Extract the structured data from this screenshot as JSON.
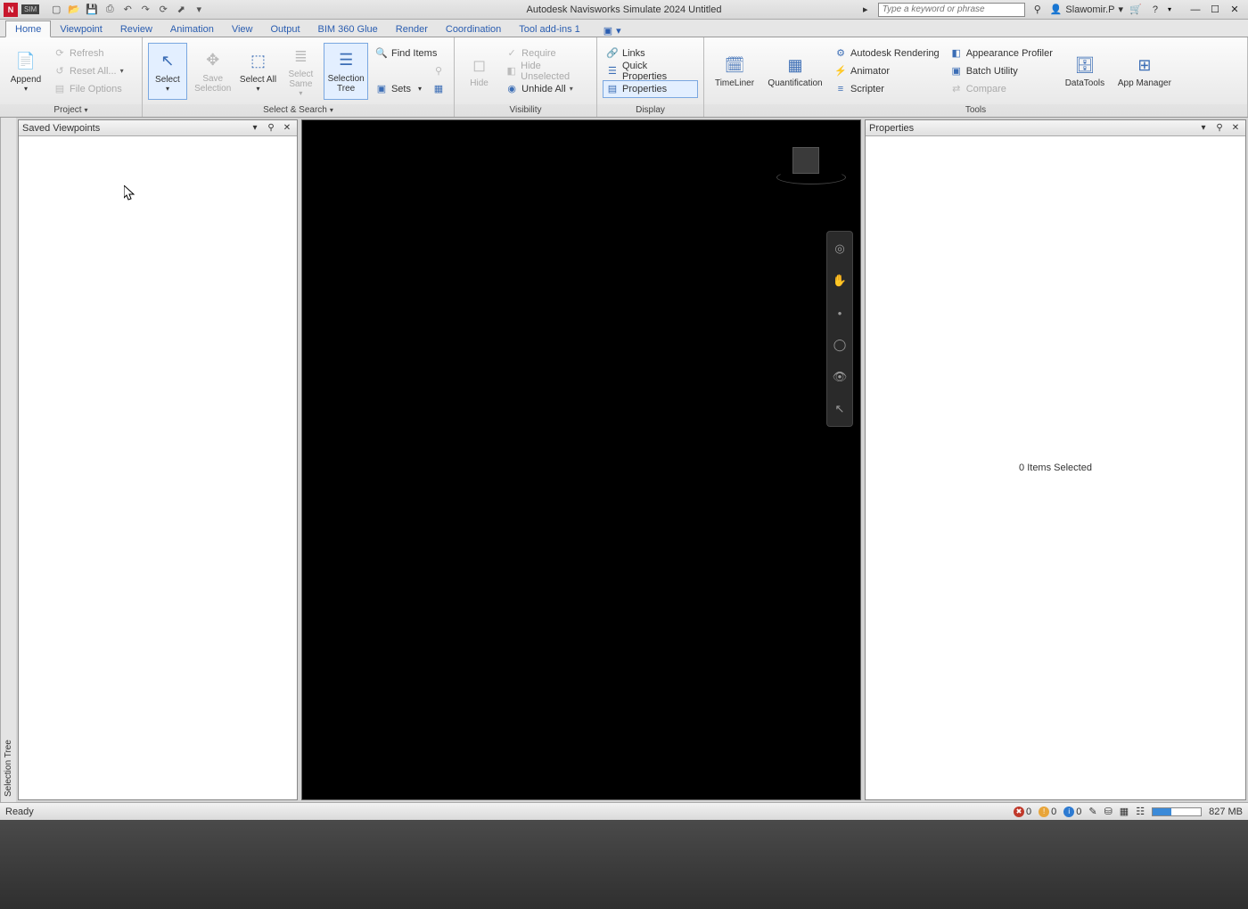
{
  "titlebar": {
    "app_abbrev": "N",
    "sim_badge": "SIM",
    "title": "Autodesk Navisworks Simulate 2024   Untitled",
    "search_placeholder": "Type a keyword or phrase",
    "user_name": "Slawomir.P"
  },
  "tabs": {
    "items": [
      "Home",
      "Viewpoint",
      "Review",
      "Animation",
      "View",
      "Output",
      "BIM 360 Glue",
      "Render",
      "Coordination",
      "Tool add-ins 1"
    ],
    "active": "Home"
  },
  "ribbon": {
    "project": {
      "append": "Append",
      "refresh": "Refresh",
      "reset_all": "Reset All...",
      "file_options": "File Options",
      "title": "Project"
    },
    "select_search": {
      "select": "Select",
      "save_selection": "Save Selection",
      "select_all": "Select All",
      "select_same": "Select Same",
      "selection_tree": "Selection Tree",
      "find_items": "Find Items",
      "sets": "Sets",
      "title": "Select & Search"
    },
    "visibility": {
      "hide": "Hide",
      "require": "Require",
      "hide_unselected": "Hide Unselected",
      "unhide_all": "Unhide All",
      "title": "Visibility"
    },
    "display": {
      "links": "Links",
      "quick_properties": "Quick Properties",
      "properties": "Properties",
      "title": "Display"
    },
    "tools_main": {
      "timeliner": "TimeLiner",
      "quantification": "Quantification",
      "autodesk_rendering": "Autodesk Rendering",
      "animator": "Animator",
      "scripter": "Scripter",
      "appearance_profiler": "Appearance Profiler",
      "batch_utility": "Batch Utility",
      "compare": "Compare",
      "datatools": "DataTools",
      "app_manager": "App Manager",
      "title": "Tools"
    }
  },
  "panels": {
    "selection_tree_tab": "Selection Tree",
    "saved_viewpoints_title": "Saved Viewpoints",
    "properties_title": "Properties",
    "properties_message": "0 Items Selected"
  },
  "statusbar": {
    "ready": "Ready",
    "err_count": "0",
    "warn_count": "0",
    "info_count": "0",
    "memory": "827 MB"
  }
}
